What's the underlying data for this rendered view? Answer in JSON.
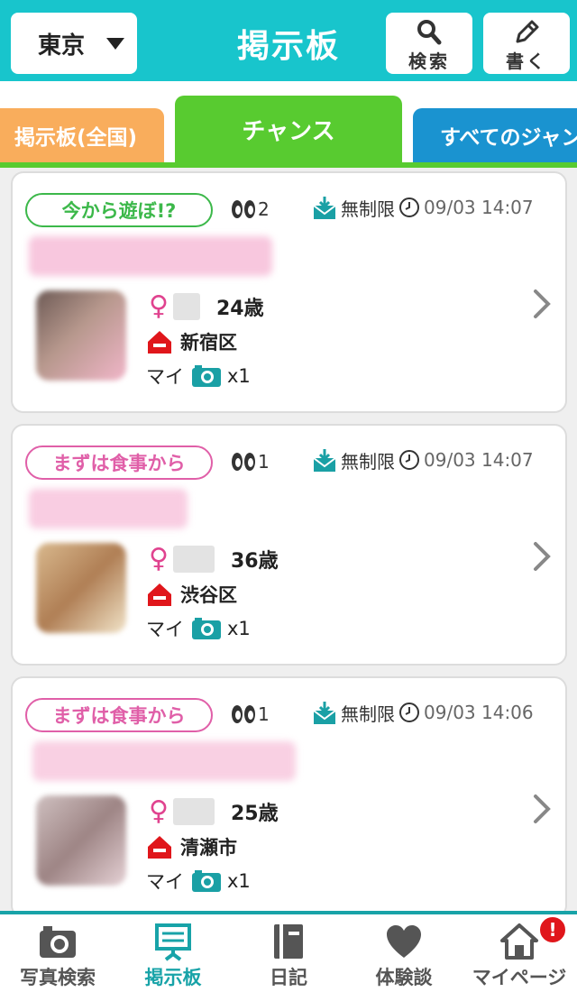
{
  "header": {
    "region": "東京",
    "title": "掲示板",
    "search_label": "検索",
    "write_label": "書く"
  },
  "tabs": [
    {
      "label": "掲示板(全国)"
    },
    {
      "label": "チャンス"
    },
    {
      "label": "すべてのジャン"
    }
  ],
  "posts": [
    {
      "category": "今から遊ぼ!?",
      "category_color": "#3cb84a",
      "views": "2",
      "reply_limit": "無制限",
      "timestamp": "09/03 14:07",
      "age": "24歳",
      "location": "新宿区",
      "owner_label": "マイ",
      "photo_count": "x1"
    },
    {
      "category": "まずは食事から",
      "category_color": "#e05fa8",
      "views": "1",
      "reply_limit": "無制限",
      "timestamp": "09/03 14:07",
      "age": "36歳",
      "location": "渋谷区",
      "owner_label": "マイ",
      "photo_count": "x1"
    },
    {
      "category": "まずは食事から",
      "category_color": "#e05fa8",
      "views": "1",
      "reply_limit": "無制限",
      "timestamp": "09/03 14:06",
      "age": "25歳",
      "location": "清瀬市",
      "owner_label": "マイ",
      "photo_count": "x1"
    }
  ],
  "bottom_nav": [
    {
      "label": "写真検索",
      "icon": "camera-icon"
    },
    {
      "label": "掲示板",
      "icon": "board-icon",
      "active": true
    },
    {
      "label": "日記",
      "icon": "notebook-icon"
    },
    {
      "label": "体験談",
      "icon": "heart-icon"
    },
    {
      "label": "マイページ",
      "icon": "home-icon"
    }
  ],
  "notification_badge": "!",
  "colors": {
    "header": "#18c5cc",
    "active_tab": "#58cb30",
    "left_tab": "#f9ad5c",
    "right_tab": "#1a93d0",
    "nav_accent": "#18a3a8"
  }
}
